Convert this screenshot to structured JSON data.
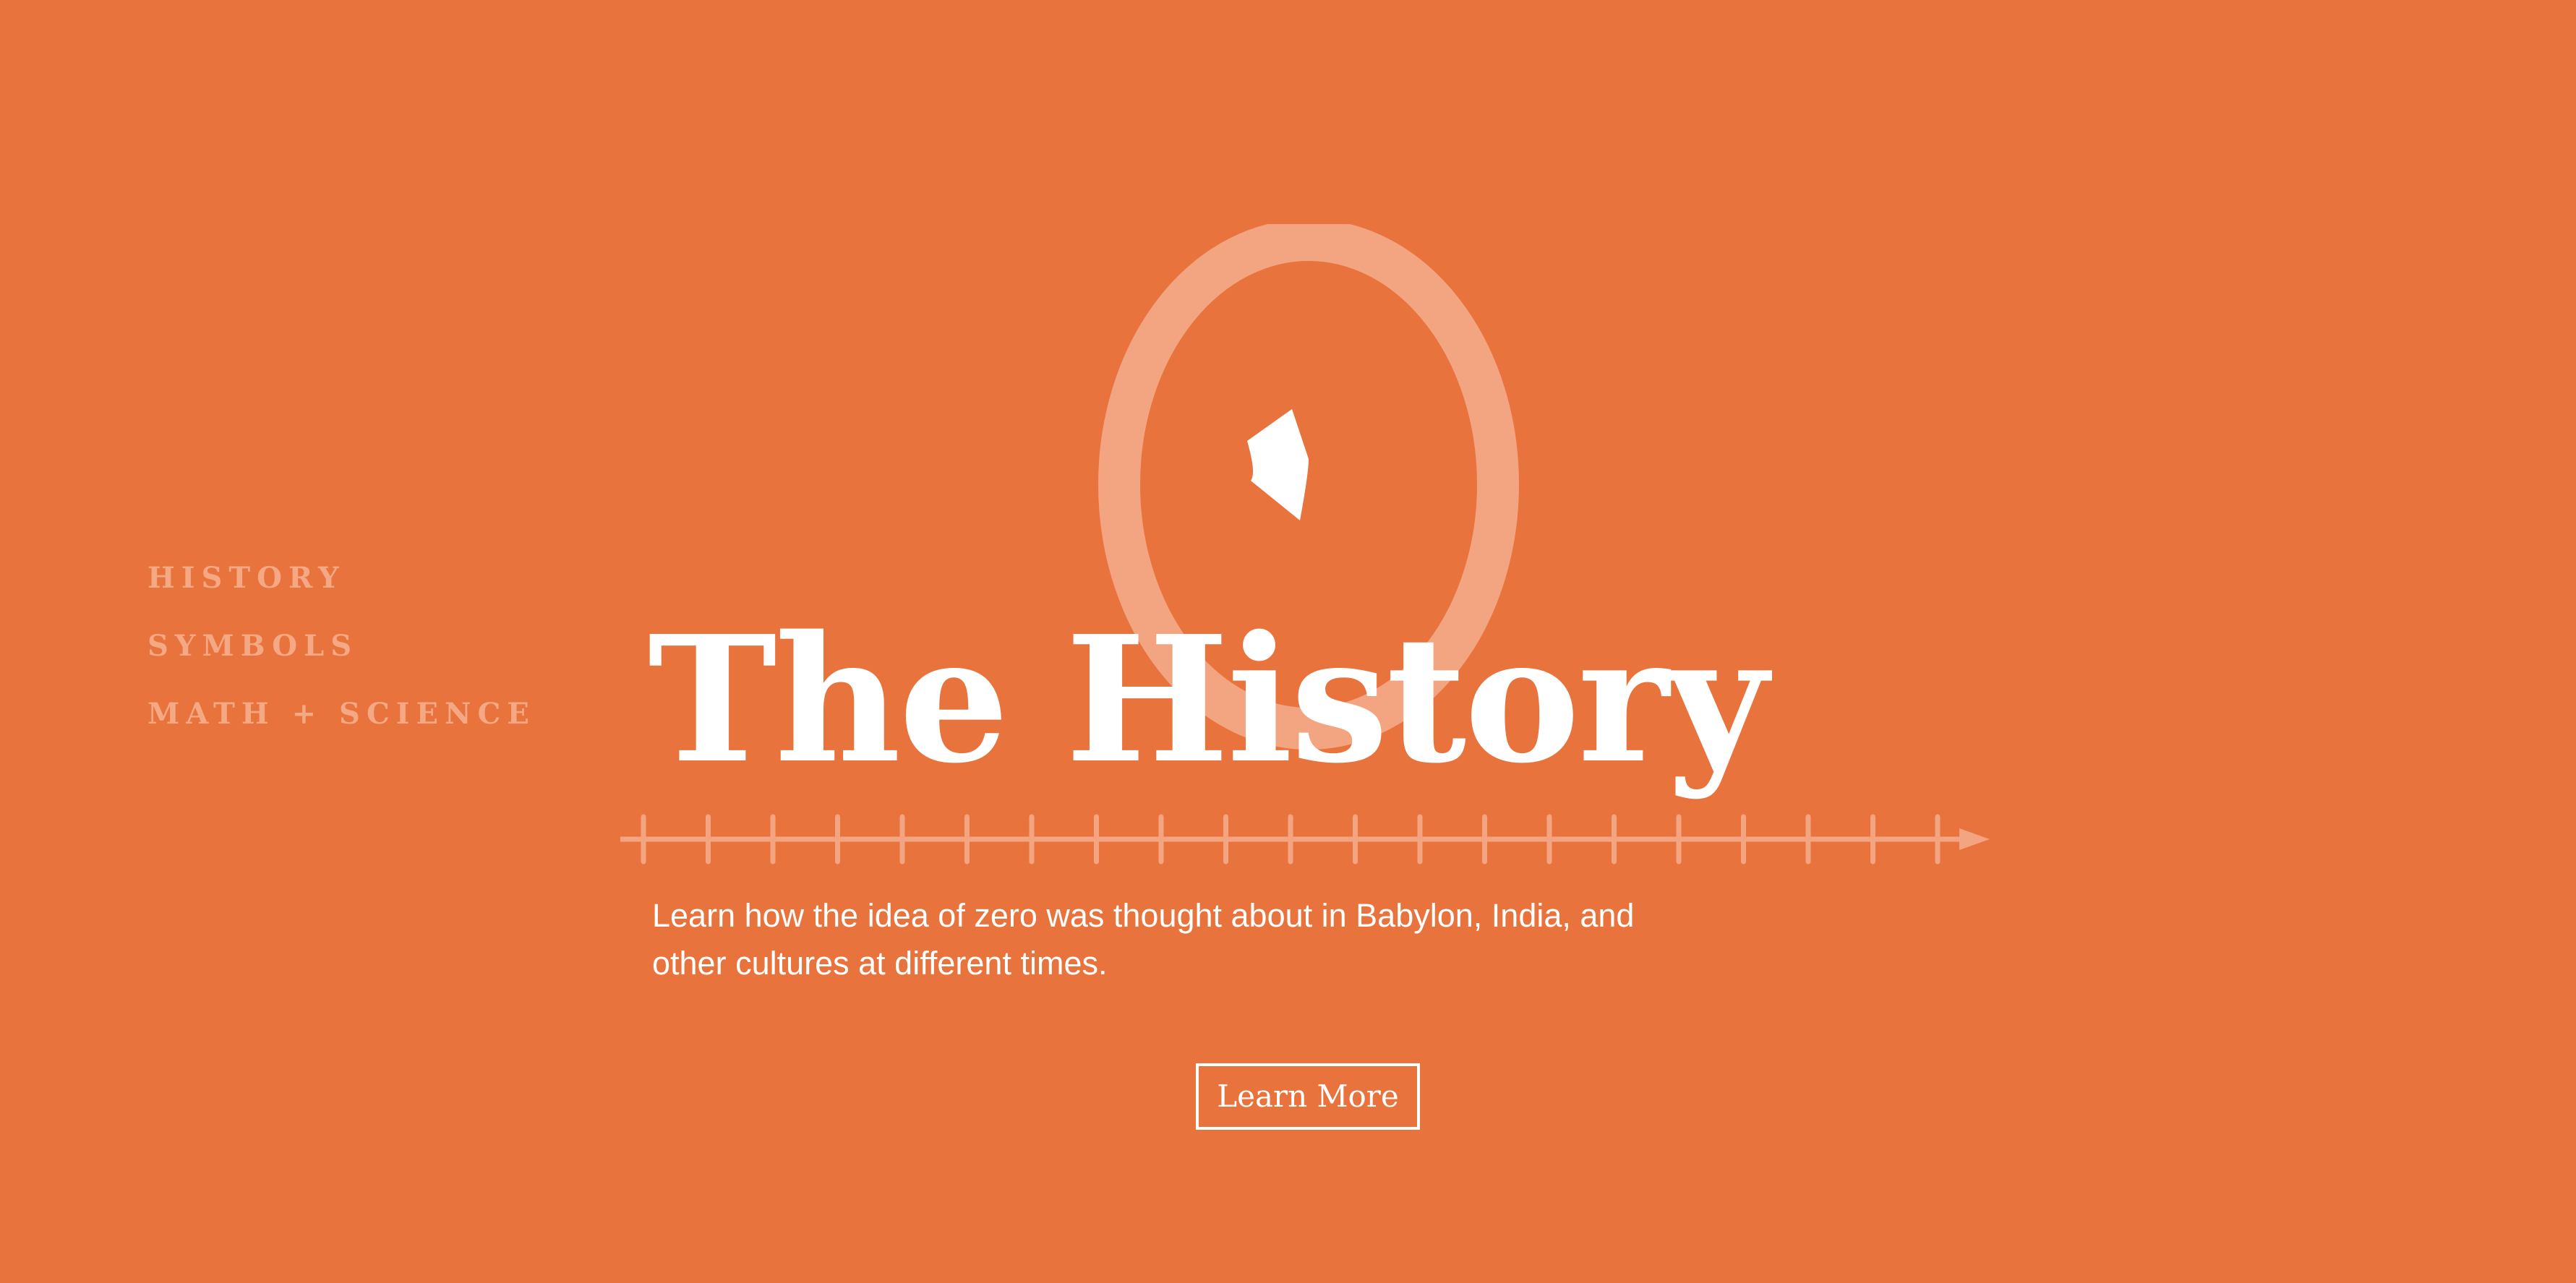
{
  "colors": {
    "background": "#E9733D",
    "nav_text": "#F5A884",
    "primary_text": "#FFFFFF",
    "zero_ring": "#F3A581",
    "axis_line": "#F3A581"
  },
  "nav": {
    "items": [
      {
        "label": "HISTORY"
      },
      {
        "label": "SYMBOLS"
      },
      {
        "label": "MATH + SCIENCE"
      }
    ]
  },
  "hero": {
    "title": "The History",
    "description": "Learn how the idea of zero was thought about in Babylon, India, and other cultures at different times.",
    "cta_label": "Learn More",
    "graphic_icon": "zero-numeral-icon",
    "timeline_icon": "number-line-icon"
  }
}
